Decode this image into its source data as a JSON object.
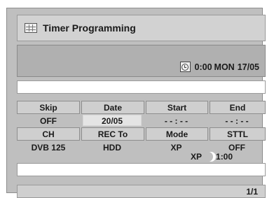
{
  "header": {
    "title": "Timer Programming",
    "icon": "timer-grid-icon"
  },
  "status": {
    "clock_icon": "clock-icon",
    "time": "0:00",
    "day": "MON",
    "date": "17/05"
  },
  "program": {
    "row1_headers": [
      "Skip",
      "Date",
      "Start",
      "End"
    ],
    "row1_values": [
      "OFF",
      "20/05",
      "- - : - -",
      "- - : - -"
    ],
    "row2_headers": [
      "CH",
      "REC To",
      "Mode",
      "STTL"
    ],
    "row2_values": [
      "DVB 125",
      "HDD",
      "XP",
      "OFF"
    ]
  },
  "remaining": {
    "mode": "XP",
    "disc_icon": "disc-space-icon",
    "time": "1:00"
  },
  "footer": {
    "page": "1/1"
  }
}
